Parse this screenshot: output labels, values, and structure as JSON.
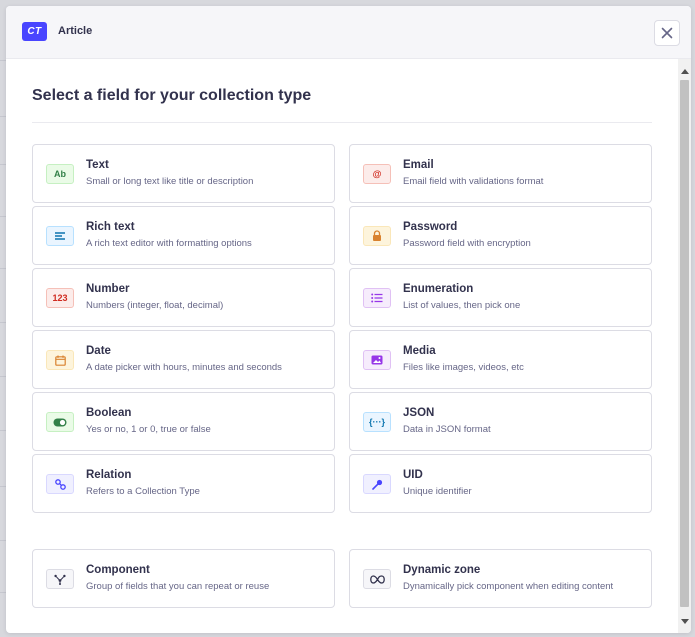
{
  "header": {
    "badge": "CT",
    "title": "Article",
    "close_icon": "close-icon"
  },
  "section": {
    "title": "Select a field for your collection type"
  },
  "fields": [
    {
      "name": "text",
      "label": "Text",
      "description": "Small or long text like title or description",
      "icon": "text-icon",
      "glyph": "Ab",
      "color": "#328048",
      "bg": "#eafbe7",
      "border": "#c6f0c2"
    },
    {
      "name": "email",
      "label": "Email",
      "description": "Email field with validations format",
      "icon": "at-icon",
      "glyph": "@",
      "color": "#d02b20",
      "bg": "#fcecea",
      "border": "#f5c0b8"
    },
    {
      "name": "rich-text",
      "label": "Rich text",
      "description": "A rich text editor with formatting options",
      "icon": "paragraph-icon",
      "glyph": "",
      "color": "#0c75af",
      "bg": "#eaf5ff",
      "border": "#b8e1ff"
    },
    {
      "name": "password",
      "label": "Password",
      "description": "Password field with encryption",
      "icon": "lock-icon",
      "glyph": "",
      "color": "#d9822f",
      "bg": "#fdf4dc",
      "border": "#fae7b9"
    },
    {
      "name": "number",
      "label": "Number",
      "description": "Numbers (integer, float, decimal)",
      "icon": "number-icon",
      "glyph": "123",
      "color": "#d02b20",
      "bg": "#fcecea",
      "border": "#f5c0b8"
    },
    {
      "name": "enumeration",
      "label": "Enumeration",
      "description": "List of values, then pick one",
      "icon": "list-icon",
      "glyph": "",
      "color": "#9736e8",
      "bg": "#f6ecfc",
      "border": "#e0c1f4"
    },
    {
      "name": "date",
      "label": "Date",
      "description": "A date picker with hours, minutes and seconds",
      "icon": "calendar-icon",
      "glyph": "",
      "color": "#d9822f",
      "bg": "#fdf4dc",
      "border": "#fae7b9"
    },
    {
      "name": "media",
      "label": "Media",
      "description": "Files like images, videos, etc",
      "icon": "picture-icon",
      "glyph": "",
      "color": "#9736e8",
      "bg": "#f6ecfc",
      "border": "#e0c1f4"
    },
    {
      "name": "boolean",
      "label": "Boolean",
      "description": "Yes or no, 1 or 0, true or false",
      "icon": "toggle-icon",
      "glyph": "",
      "color": "#328048",
      "bg": "#eafbe7",
      "border": "#c6f0c2"
    },
    {
      "name": "json",
      "label": "JSON",
      "description": "Data in JSON format",
      "icon": "braces-icon",
      "glyph": "{···}",
      "color": "#0c75af",
      "bg": "#eaf5ff",
      "border": "#b8e1ff"
    },
    {
      "name": "relation",
      "label": "Relation",
      "description": "Refers to a Collection Type",
      "icon": "link-icon",
      "glyph": "",
      "color": "#4945ff",
      "bg": "#f0f0ff",
      "border": "#d9d8ff"
    },
    {
      "name": "uid",
      "label": "UID",
      "description": "Unique identifier",
      "icon": "key-icon",
      "glyph": "",
      "color": "#4945ff",
      "bg": "#f0f0ff",
      "border": "#d9d8ff"
    }
  ],
  "extra_fields": [
    {
      "name": "component",
      "label": "Component",
      "description": "Group of fields that you can repeat or reuse",
      "icon": "component-icon",
      "glyph": "",
      "color": "#32324d",
      "bg": "#f6f6f9",
      "border": "#dcdce4"
    },
    {
      "name": "dynamic-zone",
      "label": "Dynamic zone",
      "description": "Dynamically pick component when editing content",
      "icon": "infinity-icon",
      "glyph": "",
      "color": "#32324d",
      "bg": "#f6f6f9",
      "border": "#dcdce4"
    }
  ]
}
